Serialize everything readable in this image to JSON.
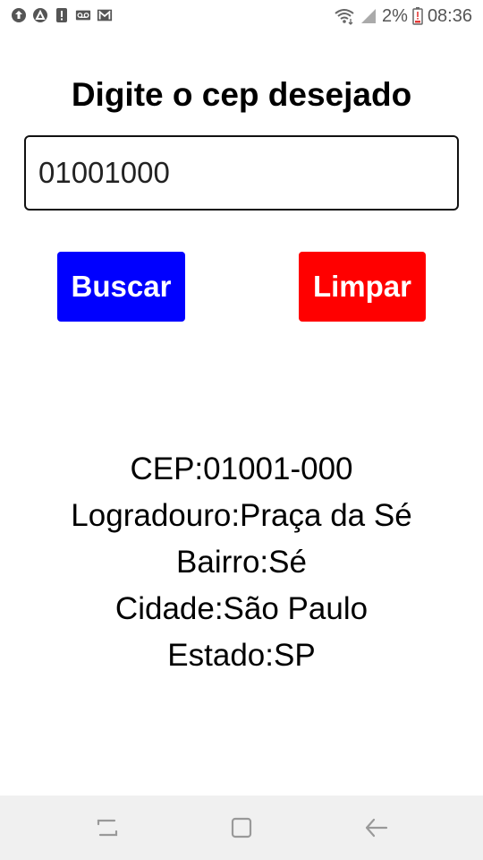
{
  "status_bar": {
    "battery_percent": "2%",
    "time": "08:36",
    "left_icons": [
      "upload-icon",
      "app-icon",
      "alert-icon",
      "voicemail-icon",
      "gmail-icon"
    ],
    "right_icons": [
      "wifi-icon",
      "signal-icon",
      "battery-icon"
    ]
  },
  "main": {
    "title": "Digite o cep desejado",
    "cep_input_value": "01001000",
    "search_button_label": "Buscar",
    "clear_button_label": "Limpar",
    "search_button_color": "#0000ff",
    "clear_button_color": "#ff0000"
  },
  "result": {
    "cep": "CEP:01001-000",
    "logradouro": "Logradouro:Praça da Sé",
    "bairro": "Bairro:Sé",
    "cidade": "Cidade:São Paulo",
    "estado": "Estado:SP"
  },
  "nav_bar": {
    "buttons": [
      "recents-icon",
      "home-icon",
      "back-icon"
    ]
  }
}
